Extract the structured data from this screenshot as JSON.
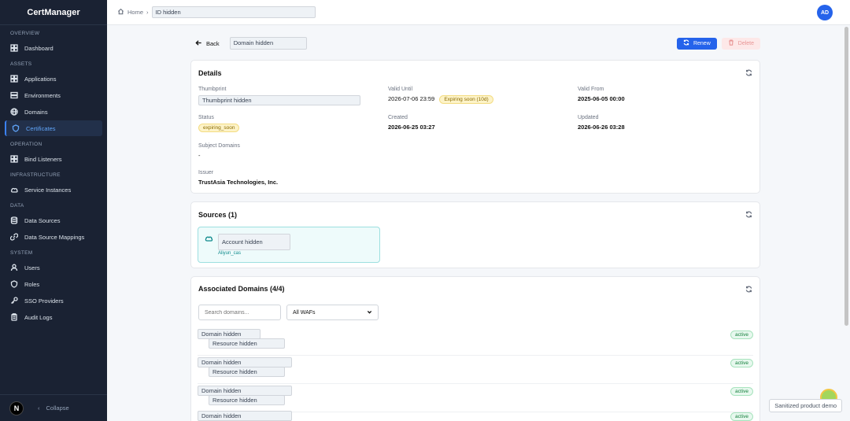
{
  "app": {
    "name": "CertManager"
  },
  "sidebar": {
    "sections": [
      {
        "title": "OVERVIEW",
        "items": [
          {
            "label": "Dashboard",
            "icon": "dashboard-icon"
          }
        ]
      },
      {
        "title": "ASSETS",
        "items": [
          {
            "label": "Applications",
            "icon": "grid-icon"
          },
          {
            "label": "Environments",
            "icon": "layers-icon"
          },
          {
            "label": "Domains",
            "icon": "globe-icon"
          },
          {
            "label": "Certificates",
            "icon": "shield-icon",
            "active": true
          }
        ]
      },
      {
        "title": "OPERATION",
        "items": [
          {
            "label": "Bind Listeners",
            "icon": "grid-icon"
          }
        ]
      },
      {
        "title": "INFRASTRUCTURE",
        "items": [
          {
            "label": "Service Instances",
            "icon": "cloud-icon"
          }
        ]
      },
      {
        "title": "DATA",
        "items": [
          {
            "label": "Data Sources",
            "icon": "database-icon"
          },
          {
            "label": "Data Source Mappings",
            "icon": "link-icon"
          }
        ]
      },
      {
        "title": "SYSTEM",
        "items": [
          {
            "label": "Users",
            "icon": "user-icon"
          },
          {
            "label": "Roles",
            "icon": "shield-icon"
          },
          {
            "label": "SSO Providers",
            "icon": "key-icon"
          },
          {
            "label": "Audit Logs",
            "icon": "clipboard-icon"
          }
        ]
      }
    ],
    "footer": {
      "logo": "N",
      "collapse": "Collapse"
    }
  },
  "topbar": {
    "home": "Home",
    "id": "ID hidden",
    "avatar": "AD"
  },
  "header": {
    "back": "Back",
    "title": "Domain hidden",
    "renew": "Renew",
    "delete": "Delete"
  },
  "details": {
    "title": "Details",
    "thumbprint_label": "Thumbprint",
    "thumbprint": "Thumbprint hidden",
    "valid_until_label": "Valid Until",
    "valid_until": "2026-07-06 23:59",
    "expiring_badge": "Expiring soon (10d)",
    "valid_from_label": "Valid From",
    "valid_from": "2025-06-05 00:00",
    "status_label": "Status",
    "status": "expiring_soon",
    "created_label": "Created",
    "created": "2026-06-25 03:27",
    "updated_label": "Updated",
    "updated": "2026-06-26 03:28",
    "subject_label": "Subject Domains",
    "subject": "-",
    "issuer_label": "Issuer",
    "issuer": "TrustAsia Technologies, Inc."
  },
  "sources": {
    "title": "Sources (1)",
    "account": "Account hidden",
    "provider": "Aliyun_cas"
  },
  "associated": {
    "title": "Associated Domains (4/4)",
    "search_placeholder": "Search domains...",
    "filter": "All WAFs",
    "rows": [
      {
        "domain": "Domain hidden",
        "resource": "Resource hidden",
        "status": "active"
      },
      {
        "domain": "Domain hidden",
        "resource": "Resource hidden",
        "status": "active"
      },
      {
        "domain": "Domain hidden",
        "resource": "Resource hidden",
        "status": "active"
      },
      {
        "domain": "Domain hidden",
        "resource": "",
        "status": "active"
      }
    ]
  },
  "toast": "Sanitized product demo",
  "colors": {
    "primary": "#2563eb",
    "sidebar_bg": "#1a2233",
    "active_badge": "#15803d",
    "warn_badge": "#fdf3c8"
  }
}
